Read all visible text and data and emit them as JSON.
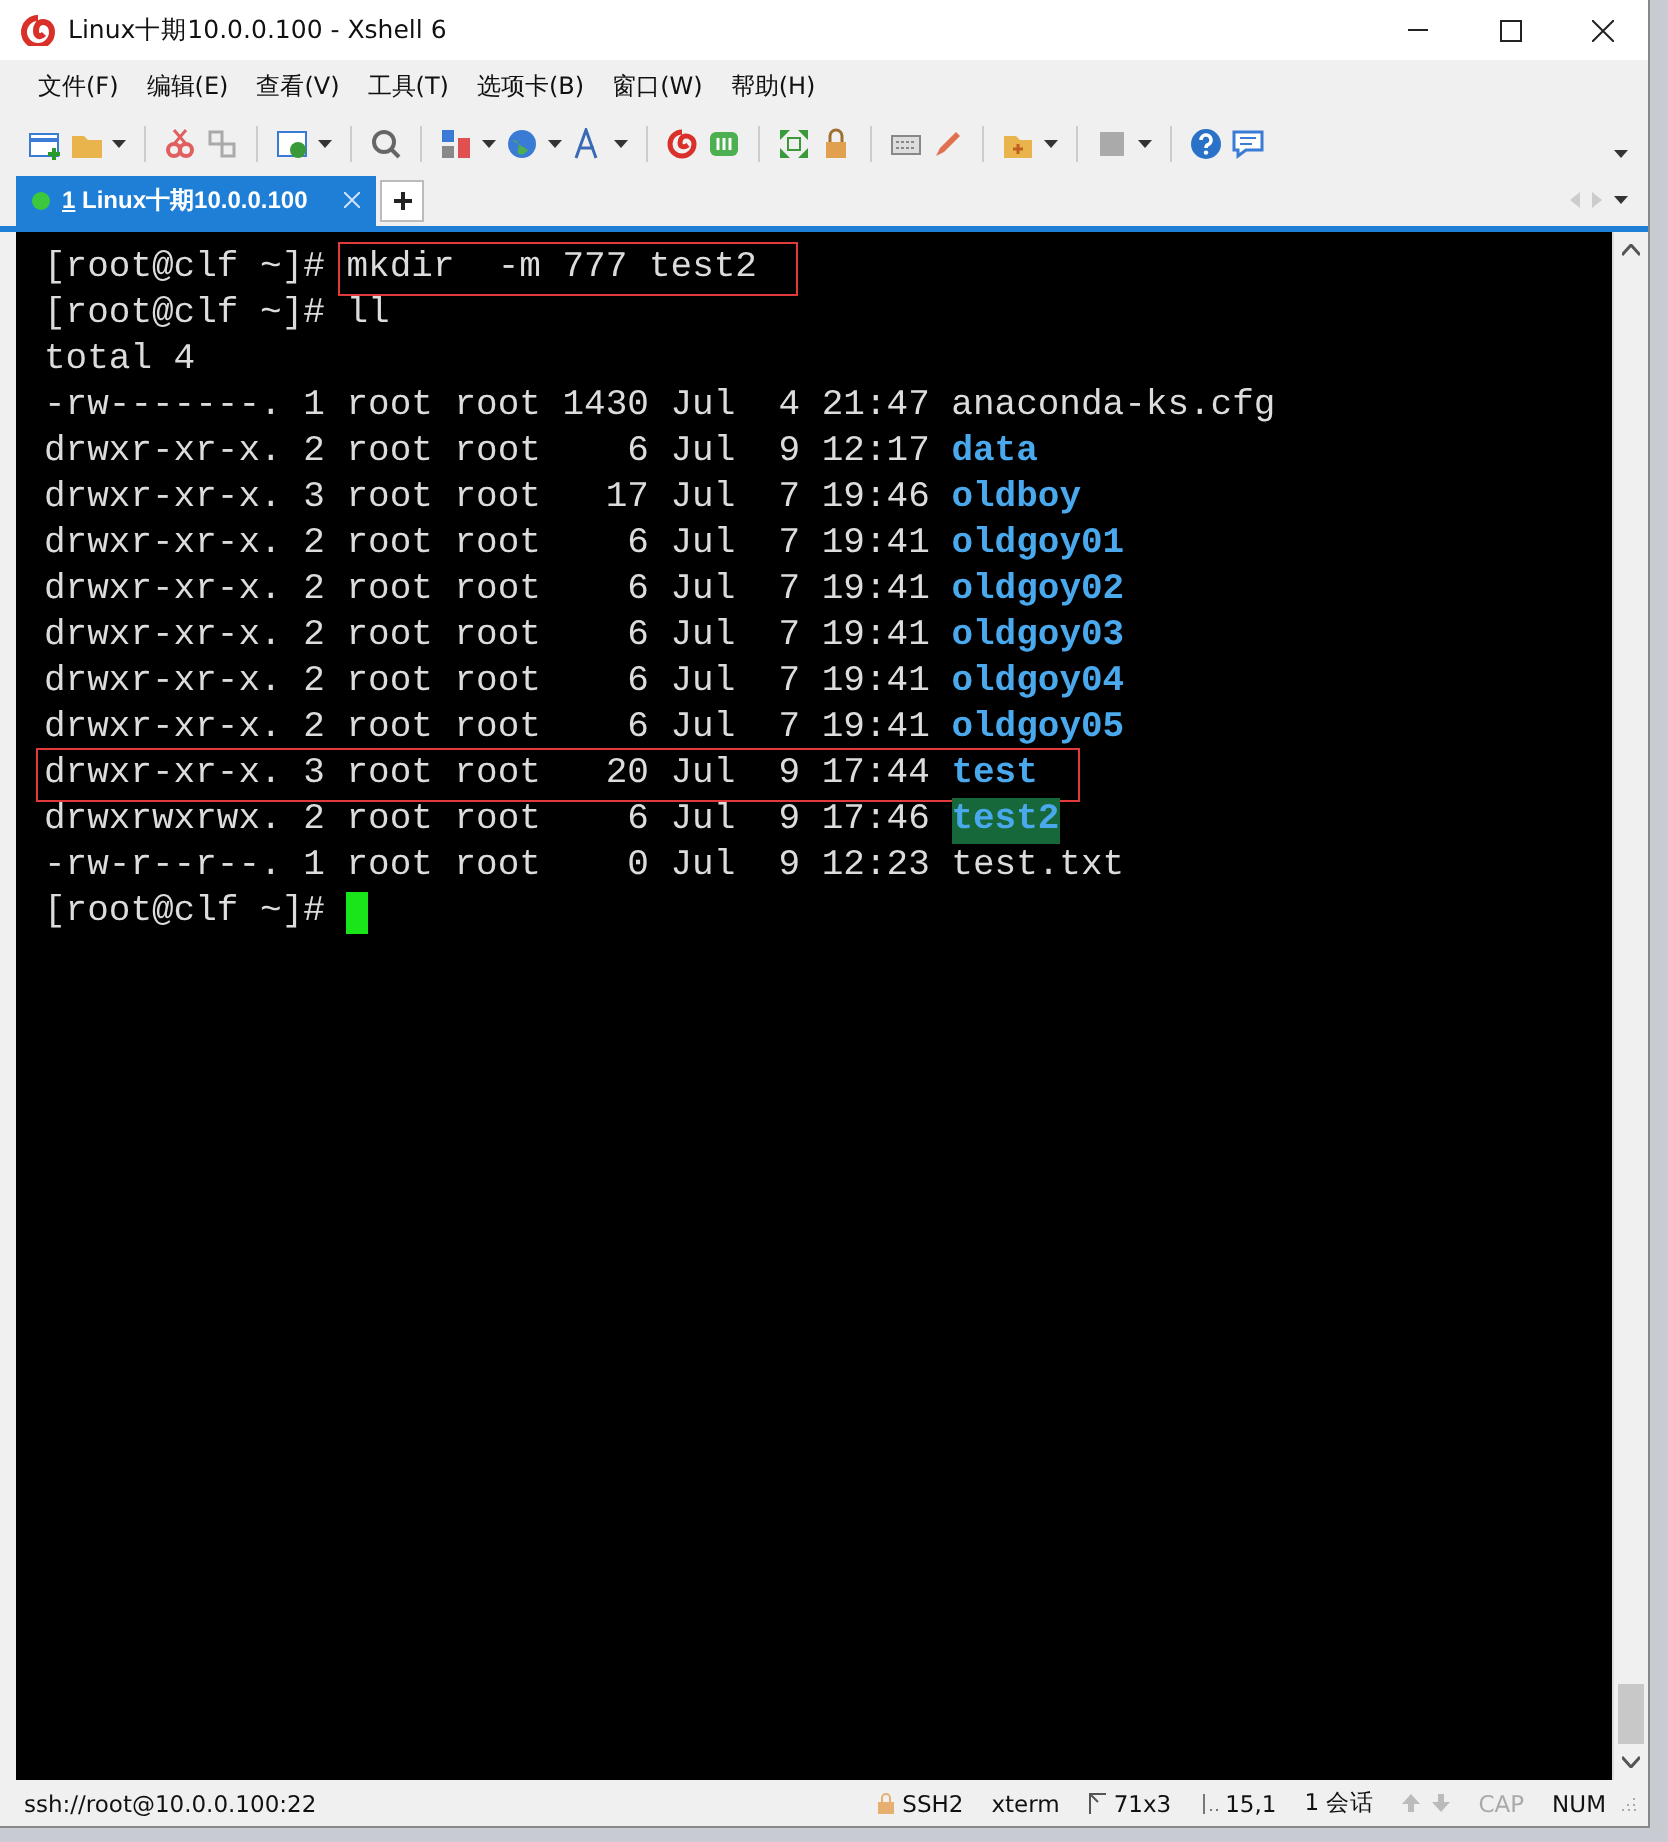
{
  "window": {
    "title": "Linux十期10.0.0.100 - Xshell 6"
  },
  "menu": [
    "文件(F)",
    "编辑(E)",
    "查看(V)",
    "工具(T)",
    "选项卡(B)",
    "窗口(W)",
    "帮助(H)"
  ],
  "tabs": [
    {
      "number": "1",
      "label": "Linux十期10.0.0.100",
      "selected": true,
      "connected": true
    }
  ],
  "terminal": {
    "cursor": true,
    "lines": [
      {
        "segments": [
          {
            "text": "[root@clf ~]# ",
            "kind": "plain",
            "boxed": false
          },
          {
            "text": "mkdir  -m 777 test2",
            "kind": "plain",
            "boxed": true
          }
        ]
      },
      {
        "segments": [
          {
            "text": "[root@clf ~]# ll",
            "kind": "plain",
            "boxed": false
          }
        ]
      },
      {
        "segments": [
          {
            "text": "total 4",
            "kind": "plain",
            "boxed": false
          }
        ]
      },
      {
        "segments": [
          {
            "text": "-rw-------. 1 root root 1430 Jul  4 21:47 anaconda-ks.cfg",
            "kind": "plain",
            "boxed": false
          }
        ]
      },
      {
        "segments": [
          {
            "text": "drwxr-xr-x. 2 root root    6 Jul  9 12:17 ",
            "kind": "plain",
            "boxed": false
          },
          {
            "text": "data",
            "kind": "dir",
            "boxed": false
          }
        ]
      },
      {
        "segments": [
          {
            "text": "drwxr-xr-x. 3 root root   17 Jul  7 19:46 ",
            "kind": "plain",
            "boxed": false
          },
          {
            "text": "oldboy",
            "kind": "dir",
            "boxed": false
          }
        ]
      },
      {
        "segments": [
          {
            "text": "drwxr-xr-x. 2 root root    6 Jul  7 19:41 ",
            "kind": "plain",
            "boxed": false
          },
          {
            "text": "oldgoy01",
            "kind": "dir",
            "boxed": false
          }
        ]
      },
      {
        "segments": [
          {
            "text": "drwxr-xr-x. 2 root root    6 Jul  7 19:41 ",
            "kind": "plain",
            "boxed": false
          },
          {
            "text": "oldgoy02",
            "kind": "dir",
            "boxed": false
          }
        ]
      },
      {
        "segments": [
          {
            "text": "drwxr-xr-x. 2 root root    6 Jul  7 19:41 ",
            "kind": "plain",
            "boxed": false
          },
          {
            "text": "oldgoy03",
            "kind": "dir",
            "boxed": false
          }
        ]
      },
      {
        "segments": [
          {
            "text": "drwxr-xr-x. 2 root root    6 Jul  7 19:41 ",
            "kind": "plain",
            "boxed": false
          },
          {
            "text": "oldgoy04",
            "kind": "dir",
            "boxed": false
          }
        ]
      },
      {
        "segments": [
          {
            "text": "drwxr-xr-x. 2 root root    6 Jul  7 19:41 ",
            "kind": "plain",
            "boxed": false
          },
          {
            "text": "oldgoy05",
            "kind": "dir",
            "boxed": false
          }
        ]
      },
      {
        "segments": [
          {
            "text": "drwxr-xr-x. 3 root root   20 Jul  9 17:44 ",
            "kind": "plain",
            "boxed": true
          },
          {
            "text": "test",
            "kind": "dir",
            "boxed": true
          }
        ]
      },
      {
        "segments": [
          {
            "text": "drwxrwxrwx. 2 root root    6 Jul  9 17:46 ",
            "kind": "plain",
            "boxed": false
          },
          {
            "text": "test2",
            "kind": "dir_world_writable",
            "boxed": false
          }
        ]
      },
      {
        "segments": [
          {
            "text": "-rw-r--r--. 1 root root    0 Jul  9 12:23 test.txt",
            "kind": "plain",
            "boxed": false
          }
        ]
      },
      {
        "segments": [
          {
            "text": "[root@clf ~]# ",
            "kind": "plain",
            "boxed": false
          }
        ]
      }
    ]
  },
  "status_bar": {
    "connection": "ssh://root@10.0.0.100:22",
    "items": [
      {
        "kind": "protocol",
        "text": "SSH2"
      },
      {
        "kind": "plain",
        "text": "xterm"
      },
      {
        "kind": "size",
        "text": "71x3"
      },
      {
        "kind": "position",
        "text": "15,1"
      },
      {
        "kind": "plain",
        "text": "1 会话"
      }
    ],
    "keys": [
      {
        "text": "CAP",
        "on": false
      },
      {
        "text": "NUM",
        "on": true
      }
    ]
  }
}
